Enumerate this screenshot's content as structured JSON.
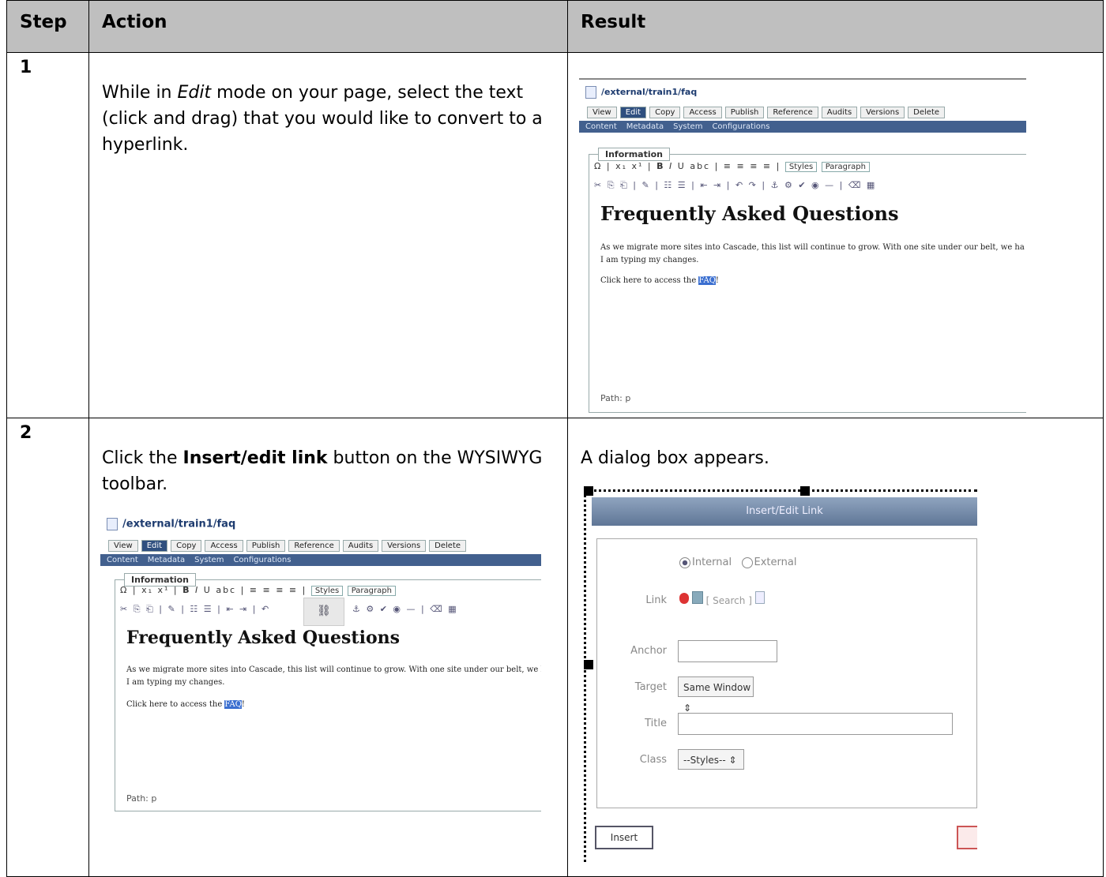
{
  "table": {
    "headers": [
      "Step",
      "Action",
      "Result"
    ],
    "rows": [
      {
        "step": "1",
        "action_parts": [
          "While in ",
          "Edit",
          " mode on your page, select the text (click and drag) that you would like to convert to a hyperlink."
        ],
        "result_text": ""
      },
      {
        "step": "2",
        "action_parts": [
          "Click the ",
          "Insert/edit link",
          " button on the WYSIWYG toolbar."
        ],
        "result_text": "A dialog box appears."
      }
    ]
  },
  "cms": {
    "path": "/external/train1/faq",
    "tabs": [
      "View",
      "Edit",
      "Copy",
      "Access",
      "Publish",
      "Reference",
      "Audits",
      "Versions",
      "Delete"
    ],
    "subtabs": [
      "Content",
      "Metadata",
      "System",
      "Configurations"
    ],
    "section_label": "Information",
    "styles_select": "Styles",
    "format_select": "Paragraph",
    "heading": "Frequently Asked Questions",
    "para1_line1": "As we migrate more sites into Cascade, this list will continue to grow.  With one site under our belt, we ha",
    "para1_line2": "I am typing my changes.",
    "para2_prefix": "Click here to access the ",
    "para2_link": "FAQ",
    "para2_suffix": "!",
    "path_status": "Path: p"
  },
  "dialog": {
    "title": "Insert/Edit Link",
    "radio_internal": "Internal",
    "radio_external": "External",
    "link_label": "Link",
    "search_label": "[ Search ]",
    "anchor_label": "Anchor",
    "target_label": "Target",
    "target_value": "Same Window",
    "title_label": "Title",
    "class_label": "Class",
    "class_value": "--Styles--",
    "insert_button": "Insert"
  }
}
